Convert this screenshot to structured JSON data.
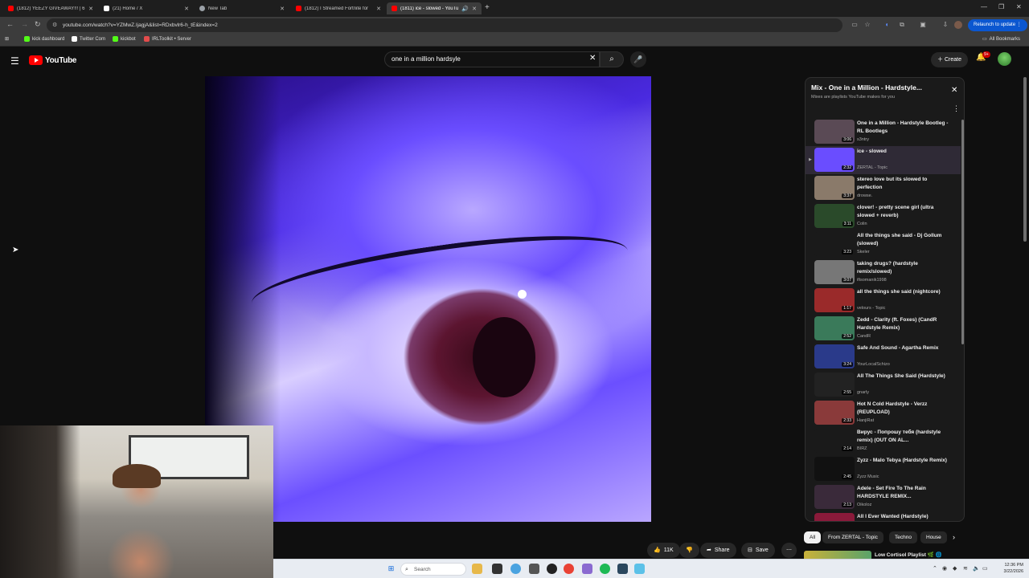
{
  "browser": {
    "tabs": [
      {
        "title": "(1812) YEEZY GIVEAWAY!!! | 67",
        "color": "#ff0000"
      },
      {
        "title": "(21) Home / X",
        "color": "#ffffff"
      },
      {
        "title": "New Tab",
        "color": "#9aa0a6"
      },
      {
        "title": "(1812) I Streamed Fortnite for",
        "color": "#ff0000"
      },
      {
        "title": "(1811) ice - slowed - YouTub",
        "color": "#ff0000",
        "active": true
      }
    ],
    "url": "youtube.com/watch?v=YZMwZ.IjagjA&list=RDxbvlr6-h_tE&index=2",
    "relaunch_label": "Relaunch to update",
    "all_bookmarks_label": "All Bookmarks",
    "bookmarks": [
      {
        "label": "kick dashboard",
        "color": "#53fc18"
      },
      {
        "label": "Twitter Com",
        "color": "#ffffff"
      },
      {
        "label": "kickbot",
        "color": "#53fc18"
      },
      {
        "label": "IRLToolkit • Server",
        "color": "#e34c4c"
      }
    ]
  },
  "youtube": {
    "logo_text": "YouTube",
    "search_value": "one in a million hardsyle",
    "create_label": "Create",
    "notif_count": "9+"
  },
  "actions": {
    "likes": "11K",
    "share": "Share",
    "save": "Save"
  },
  "playlist": {
    "title": "Mix - One in a Million - Hardstyle...",
    "subtitle": "Mixes are playlists YouTube makes for you",
    "items": [
      {
        "title": "One in a Million - Hardstyle Bootleg - RL Bootlegs",
        "channel": "s3ntry",
        "duration": "3:06",
        "thumb": "#5a4a55"
      },
      {
        "title": "ice - slowed",
        "channel": "ZERTAL - Topic",
        "duration": "2:32",
        "thumb": "#6a4dff",
        "current": true
      },
      {
        "title": "stereo love but its slowed to perfection",
        "channel": "drowse.",
        "duration": "3:37",
        "thumb": "#8a7a6a"
      },
      {
        "title": "clover! - pretty scene girl (ultra slowed + reverb)",
        "channel": "Colin",
        "duration": "3:11",
        "thumb": "#2a4a2a"
      },
      {
        "title": "All the things she said - Dj Gollum (slowed)",
        "channel": "Skeler",
        "duration": "3:23",
        "thumb": "#1a1a1a"
      },
      {
        "title": "taking drugs? (hardstyle remix/slowed)",
        "channel": "ifisomanik1998",
        "duration": "3:07",
        "thumb": "#777777"
      },
      {
        "title": "all the things she said (nightcore)",
        "channel": "velours - Topic",
        "duration": "1:17",
        "thumb": "#9a2a2a"
      },
      {
        "title": "Zedd - Clarity (ft. Foxes) (CandR Hardstyle Remix)",
        "channel": "CandR",
        "duration": "2:52",
        "thumb": "#3a7a5a"
      },
      {
        "title": "Safe And Sound - Agartha Remix",
        "channel": "YourLocalSchizo",
        "duration": "3:24",
        "thumb": "#2a3a8a"
      },
      {
        "title": "All The Things She Said (Hardstyle)",
        "channel": "gnarly",
        "duration": "2:55",
        "thumb": "#222222"
      },
      {
        "title": "Hot N Cold Hardstyle - Verzz (REUPLOAD)",
        "channel": "HanjiRat",
        "duration": "2:33",
        "thumb": "#8a3a3a"
      },
      {
        "title": "Вирус - Попрошу тебя (hardstyle remix) (OUT ON AL...",
        "channel": "BIRZ",
        "duration": "2:14",
        "thumb": "#1a1a1a"
      },
      {
        "title": "Zyzz - Malo Tebya (Hardstyle Remix)",
        "channel": "Zyzz Music",
        "duration": "2:45",
        "thumb": "#111111"
      },
      {
        "title": "Adele - Set Fire To The Rain HARDSTYLE REMIX...",
        "channel": "Oikoloz",
        "duration": "2:13",
        "thumb": "#3a2a3a"
      },
      {
        "title": "All I Ever Wanted (Hardstyle)",
        "channel": "",
        "duration": "",
        "thumb": "#8a1a3a"
      }
    ]
  },
  "chips": [
    "All",
    "From ZERTAL - Topic",
    "Techno",
    "House"
  ],
  "related": {
    "title": "Low Cortisol Playlist 🌿 🌐"
  },
  "taskbar": {
    "search_placeholder": "Search",
    "time": "12:36 PM",
    "date": "3/22/2026"
  }
}
